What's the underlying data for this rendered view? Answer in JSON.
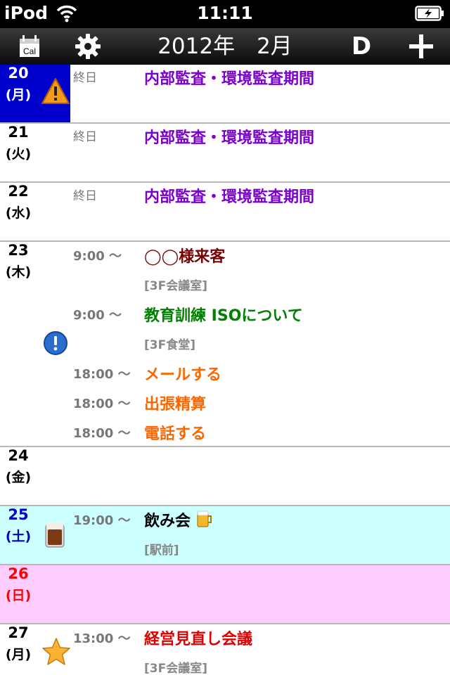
{
  "status": {
    "carrier": "iPod",
    "time": "11:11"
  },
  "toolbar": {
    "calendar_label": "Cal",
    "title": "2012年　2月",
    "day_view_label": "D"
  },
  "days": [
    {
      "num": "20",
      "weekday": "(月)",
      "events": [
        {
          "time": "終日",
          "title": "内部監査・環境監査期間"
        }
      ]
    },
    {
      "num": "21",
      "weekday": "(火)",
      "events": [
        {
          "time": "終日",
          "title": "内部監査・環境監査期間"
        }
      ]
    },
    {
      "num": "22",
      "weekday": "(水)",
      "events": [
        {
          "time": "終日",
          "title": "内部監査・環境監査期間"
        }
      ]
    },
    {
      "num": "23",
      "weekday": "(木)",
      "events": [
        {
          "time": "9:00 〜",
          "title": "◯◯様来客",
          "location": "[3F会議室]"
        },
        {
          "time": "9:00 〜",
          "title": "教育訓練  ISOについて",
          "location": "[3F食堂]"
        },
        {
          "time": "18:00 〜",
          "title": "メールする"
        },
        {
          "time": "18:00 〜",
          "title": "出張精算"
        },
        {
          "time": "18:00 〜",
          "title": "電話する"
        }
      ]
    },
    {
      "num": "24",
      "weekday": "(金)",
      "events": []
    },
    {
      "num": "25",
      "weekday": "(土)",
      "events": [
        {
          "time": "19:00 〜",
          "title": "飲み会",
          "location": "[駅前]"
        }
      ]
    },
    {
      "num": "26",
      "weekday": "(日)",
      "events": []
    },
    {
      "num": "27",
      "weekday": "(月)",
      "events": [
        {
          "time": "13:00 〜",
          "title": "経営見直し会議",
          "location": "[3F会議室]"
        }
      ]
    }
  ],
  "icons": {
    "row20": "warning-icon",
    "row23": "info-icon",
    "row25": "beer-mug-icon",
    "row27": "star-icon"
  },
  "colors": {
    "today_highlight": "#0000cc",
    "saturday_bg": "#ccffff",
    "sunday_bg": "#ffccff",
    "saturday_text": "#0000cc",
    "sunday_text": "#ff0000",
    "purple_event": "#7b00cc",
    "maroon_event": "#7a0000",
    "green_event": "#008000",
    "orange_event": "#ff6600",
    "red_event": "#e00000"
  }
}
